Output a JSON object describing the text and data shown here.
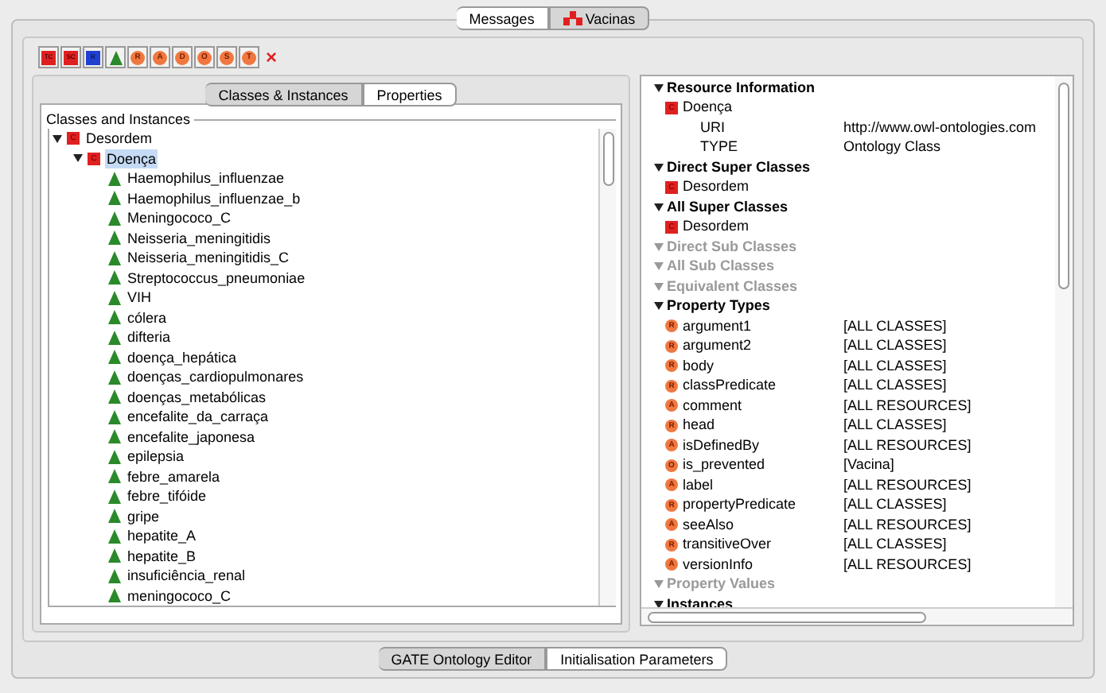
{
  "top_tabs": [
    {
      "label": "Messages",
      "selected": false,
      "icon": false
    },
    {
      "label": "Vacinas",
      "selected": true,
      "icon": true
    }
  ],
  "toolbar": [
    {
      "kind": "red_square",
      "glyph": "TC"
    },
    {
      "kind": "red_square",
      "glyph": "SC"
    },
    {
      "kind": "blue_square",
      "glyph": "R"
    },
    {
      "kind": "triangle"
    },
    {
      "kind": "circle",
      "glyph": "R"
    },
    {
      "kind": "circle",
      "glyph": "A"
    },
    {
      "kind": "circle",
      "glyph": "D"
    },
    {
      "kind": "circle",
      "glyph": "O"
    },
    {
      "kind": "circle",
      "glyph": "S"
    },
    {
      "kind": "circle",
      "glyph": "T"
    },
    {
      "kind": "close",
      "glyph": "×"
    }
  ],
  "left_tabs": [
    {
      "label": "Classes & Instances",
      "selected": true
    },
    {
      "label": "Properties",
      "selected": false
    }
  ],
  "tree_title": "Classes and Instances",
  "tree": [
    {
      "label": "Desordem",
      "kind": "class",
      "glyph": "C",
      "expanded": true,
      "selected": false,
      "children": [
        {
          "label": "Doença",
          "kind": "class",
          "glyph": "C",
          "expanded": true,
          "selected": true,
          "children": [
            {
              "label": "Haemophilus_influenzae",
              "kind": "instance",
              "selected": false
            },
            {
              "label": "Haemophilus_influenzae_b",
              "kind": "instance",
              "selected": false
            },
            {
              "label": "Meningococo_C",
              "kind": "instance",
              "selected": false
            },
            {
              "label": "Neisseria_meningitidis",
              "kind": "instance",
              "selected": false
            },
            {
              "label": "Neisseria_meningitidis_C",
              "kind": "instance",
              "selected": false
            },
            {
              "label": "Streptococcus_pneumoniae",
              "kind": "instance",
              "selected": false
            },
            {
              "label": "VIH",
              "kind": "instance",
              "selected": false
            },
            {
              "label": "cólera",
              "kind": "instance",
              "selected": false
            },
            {
              "label": "difteria",
              "kind": "instance",
              "selected": false
            },
            {
              "label": "doença_hepática",
              "kind": "instance",
              "selected": false
            },
            {
              "label": "doenças_cardiopulmonares",
              "kind": "instance",
              "selected": false
            },
            {
              "label": "doenças_metabólicas",
              "kind": "instance",
              "selected": false
            },
            {
              "label": "encefalite_da_carraça",
              "kind": "instance",
              "selected": false
            },
            {
              "label": "encefalite_japonesa",
              "kind": "instance",
              "selected": false
            },
            {
              "label": "epilepsia",
              "kind": "instance",
              "selected": false
            },
            {
              "label": "febre_amarela",
              "kind": "instance",
              "selected": false
            },
            {
              "label": "febre_tifóide",
              "kind": "instance",
              "selected": false
            },
            {
              "label": "gripe",
              "kind": "instance",
              "selected": false
            },
            {
              "label": "hepatite_A",
              "kind": "instance",
              "selected": false
            },
            {
              "label": "hepatite_B",
              "kind": "instance",
              "selected": false
            },
            {
              "label": "insuficiência_renal",
              "kind": "instance",
              "selected": false
            },
            {
              "label": "meningococo_C",
              "kind": "instance",
              "selected": false
            }
          ]
        }
      ]
    }
  ],
  "details": [
    {
      "title": "Resource Information",
      "expanded": true,
      "disabled": false,
      "items": [
        {
          "kind": "class",
          "glyph": "C",
          "name": "Doença"
        },
        {
          "kind": "plain",
          "name": "URI",
          "value": "http://www.owl-ontologies.com"
        },
        {
          "kind": "plain",
          "name": "TYPE",
          "value": "Ontology Class"
        }
      ]
    },
    {
      "title": "Direct Super Classes",
      "expanded": true,
      "disabled": false,
      "items": [
        {
          "kind": "class",
          "glyph": "C",
          "name": "Desordem"
        }
      ]
    },
    {
      "title": "All Super Classes",
      "expanded": true,
      "disabled": false,
      "items": [
        {
          "kind": "class",
          "glyph": "C",
          "name": "Desordem"
        }
      ]
    },
    {
      "title": "Direct Sub Classes",
      "expanded": true,
      "disabled": true
    },
    {
      "title": "All Sub Classes",
      "expanded": true,
      "disabled": true
    },
    {
      "title": "Equivalent Classes",
      "expanded": true,
      "disabled": true
    },
    {
      "title": "Property Types",
      "expanded": true,
      "disabled": false,
      "items": [
        {
          "kind": "property",
          "glyph": "R",
          "name": "argument1",
          "value": "[ALL CLASSES]"
        },
        {
          "kind": "property",
          "glyph": "R",
          "name": "argument2",
          "value": "[ALL CLASSES]"
        },
        {
          "kind": "property",
          "glyph": "R",
          "name": "body",
          "value": "[ALL CLASSES]"
        },
        {
          "kind": "property",
          "glyph": "R",
          "name": "classPredicate",
          "value": "[ALL CLASSES]"
        },
        {
          "kind": "property",
          "glyph": "A",
          "name": "comment",
          "value": "[ALL RESOURCES]"
        },
        {
          "kind": "property",
          "glyph": "R",
          "name": "head",
          "value": "[ALL CLASSES]"
        },
        {
          "kind": "property",
          "glyph": "A",
          "name": "isDefinedBy",
          "value": "[ALL RESOURCES]"
        },
        {
          "kind": "property",
          "glyph": "O",
          "name": "is_prevented",
          "value": "[Vacina]"
        },
        {
          "kind": "property",
          "glyph": "A",
          "name": "label",
          "value": "[ALL RESOURCES]"
        },
        {
          "kind": "property",
          "glyph": "R",
          "name": "propertyPredicate",
          "value": "[ALL CLASSES]"
        },
        {
          "kind": "property",
          "glyph": "A",
          "name": "seeAlso",
          "value": "[ALL RESOURCES]"
        },
        {
          "kind": "property",
          "glyph": "R",
          "name": "transitiveOver",
          "value": "[ALL CLASSES]"
        },
        {
          "kind": "property",
          "glyph": "A",
          "name": "versionInfo",
          "value": "[ALL RESOURCES]"
        }
      ]
    },
    {
      "title": "Property Values",
      "expanded": true,
      "disabled": true
    },
    {
      "title": "Instances",
      "expanded": true,
      "disabled": false
    }
  ],
  "bottom_tabs": [
    {
      "label": "GATE Ontology Editor",
      "selected": true
    },
    {
      "label": "Initialisation Parameters",
      "selected": false
    }
  ]
}
